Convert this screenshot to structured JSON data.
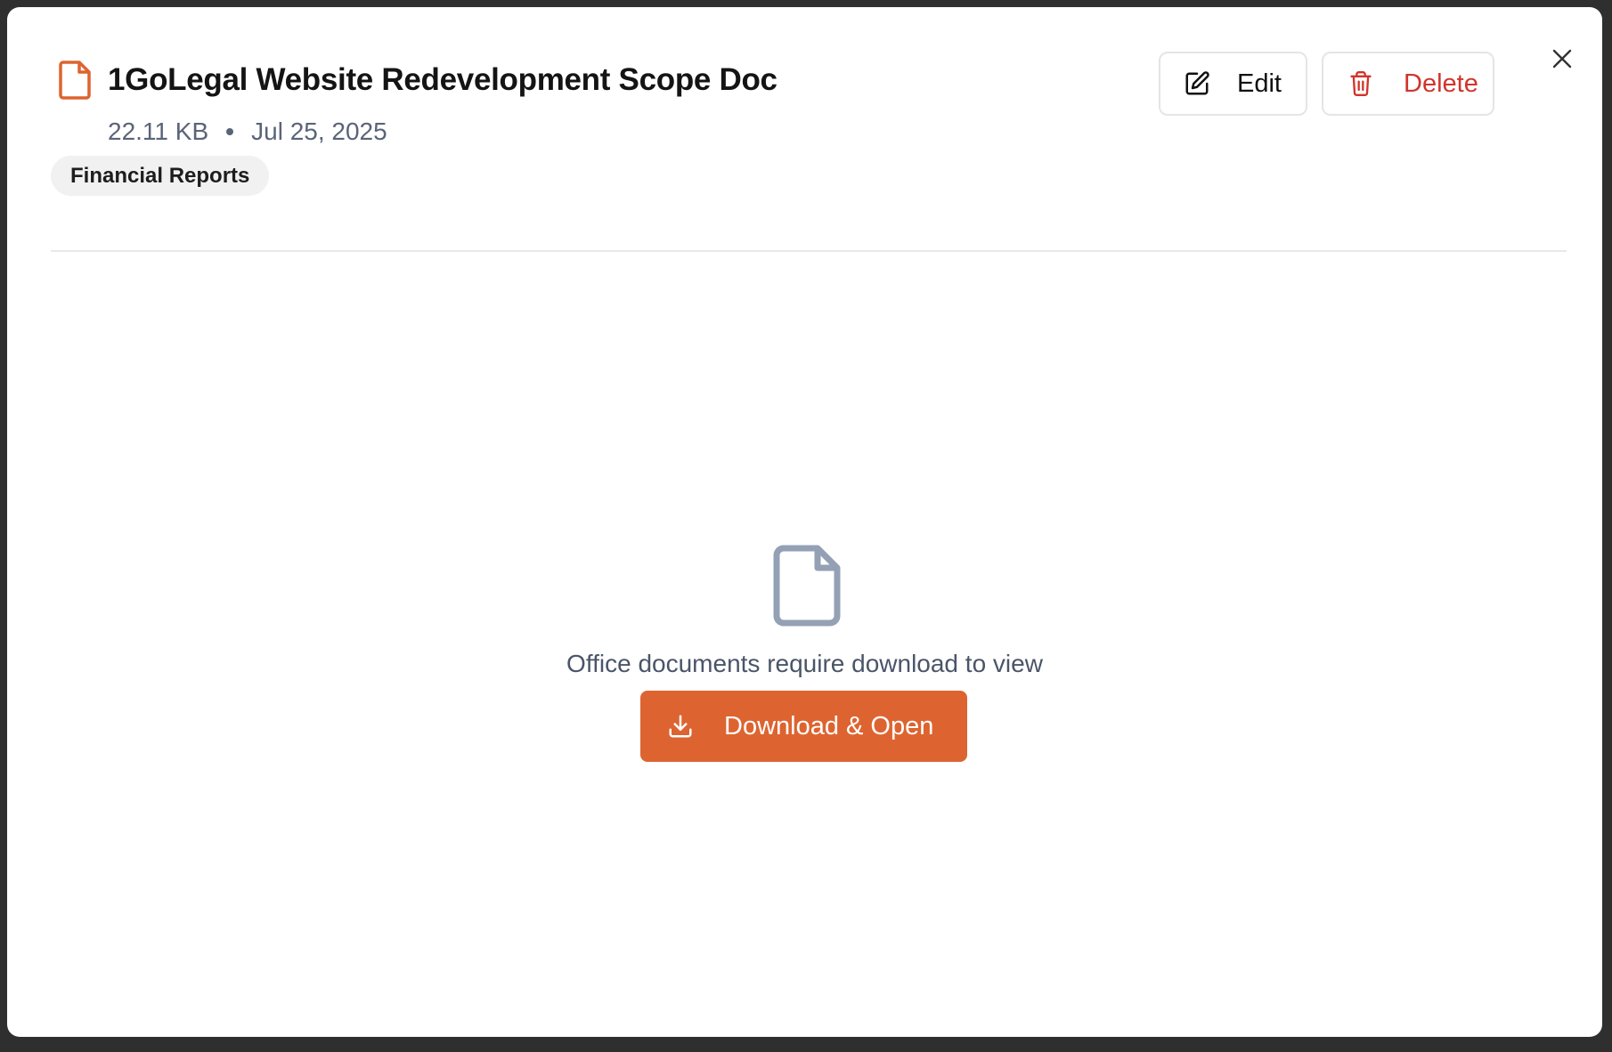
{
  "document": {
    "title": "1GoLegal Website Redevelopment Scope Doc",
    "size": "22.11 KB",
    "date": "Jul 25, 2025",
    "tag": "Financial Reports",
    "icon": "file-icon"
  },
  "actions": {
    "edit_label": "Edit",
    "delete_label": "Delete",
    "close_icon": "close-icon"
  },
  "preview": {
    "message": "Office documents require download to view",
    "download_label": "Download & Open",
    "icon": "file-icon"
  },
  "colors": {
    "accent": "#dd6430",
    "danger": "#d0342c",
    "muted_icon": "#94a0b4",
    "backdrop": "#2f2f2f"
  }
}
